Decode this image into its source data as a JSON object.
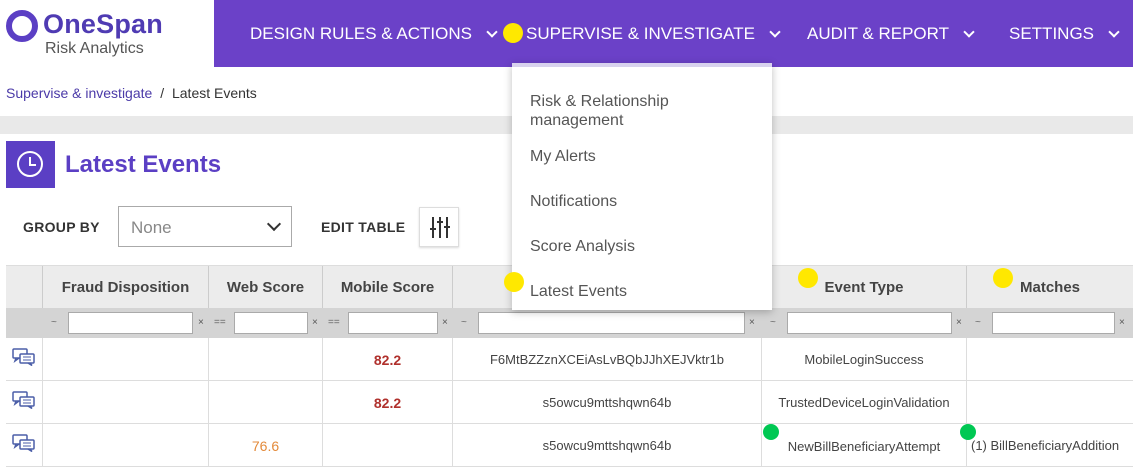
{
  "header": {
    "logo_name": "OneSpan",
    "logo_sub": "Risk Analytics",
    "nav": [
      {
        "label": "DESIGN RULES & ACTIONS"
      },
      {
        "label": "SUPERVISE & INVESTIGATE"
      },
      {
        "label": "AUDIT & REPORT"
      },
      {
        "label": "SETTINGS"
      }
    ]
  },
  "breadcrumb": {
    "parent": "Supervise & investigate",
    "separator": "/",
    "current": "Latest Events"
  },
  "page": {
    "title": "Latest Events",
    "icon": "clock-icon"
  },
  "toolbar": {
    "group_by_label": "GROUP BY",
    "group_by_value": "None",
    "edit_table_label": "EDIT TABLE",
    "edit_icon": "sliders-icon"
  },
  "table": {
    "columns": [
      {
        "label": "Fraud Disposition"
      },
      {
        "label": "Web Score"
      },
      {
        "label": "Mobile Score"
      },
      {
        "label": ""
      },
      {
        "label": "Event Type"
      },
      {
        "label": "Matches"
      }
    ],
    "filter_ops": [
      "~",
      "==",
      "==",
      "~",
      "~",
      "~"
    ],
    "filter_clear": "×",
    "rows": [
      {
        "fraud": "",
        "web": "",
        "mobile": "82.2",
        "device": "F6MtBZZznXCEiAsLvBQbJJhXEJVktr1b",
        "event": "MobileLoginSuccess",
        "matches": ""
      },
      {
        "fraud": "",
        "web": "",
        "mobile": "82.2",
        "device": "s5owcu9mttshqwn64b",
        "event": "TrustedDeviceLoginValidation",
        "matches": ""
      },
      {
        "fraud": "",
        "web": "76.6",
        "mobile": "",
        "device": "s5owcu9mttshqwn64b",
        "event": "NewBillBeneficiaryAttempt",
        "matches": "(1) BillBeneficiaryAddition"
      }
    ]
  },
  "dropdown": {
    "items": [
      {
        "label": "Risk & Relationship management"
      },
      {
        "label": "My Alerts"
      },
      {
        "label": "Notifications"
      },
      {
        "label": "Score Analysis"
      },
      {
        "label": "Latest Events"
      }
    ]
  },
  "colors": {
    "brand": "#6b41c8",
    "accent": "#5b3fc4",
    "score_high": "#b0302c",
    "score_medium": "#e38a3a"
  }
}
